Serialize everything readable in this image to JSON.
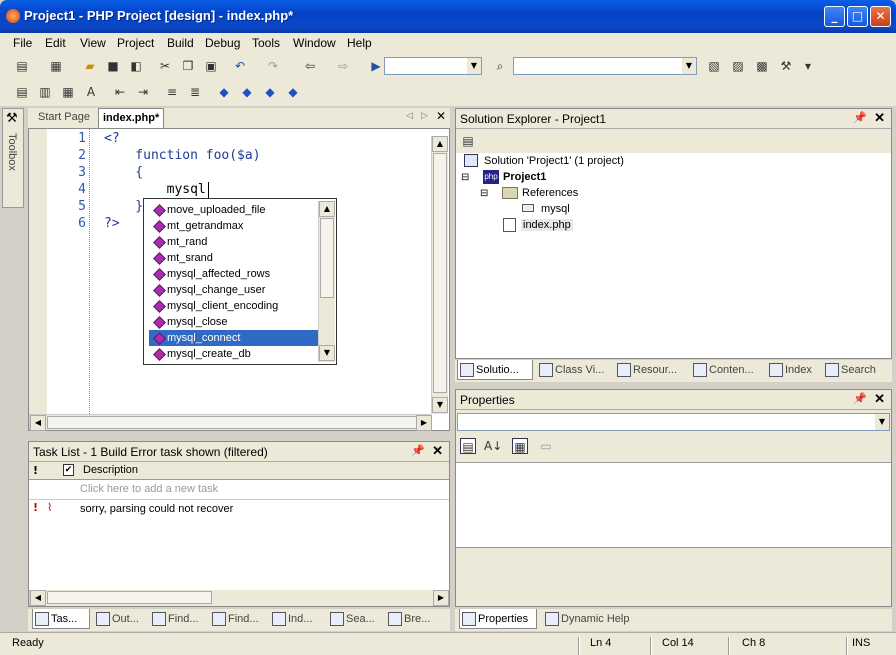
{
  "window": {
    "title": "Project1 - PHP Project [design] - index.php*",
    "min": "_",
    "max": "□",
    "close": "✕"
  },
  "menu": [
    "File",
    "Edit",
    "View",
    "Project",
    "Build",
    "Debug",
    "Tools",
    "Window",
    "Help"
  ],
  "toolbox": {
    "label": "Toolbox"
  },
  "editor": {
    "tabs": [
      "Start Page",
      "index.php*"
    ],
    "lines": [
      {
        "n": "1",
        "t": "<?"
      },
      {
        "n": "2",
        "t": "    function foo($a)"
      },
      {
        "n": "3",
        "t": "    {"
      },
      {
        "n": "4",
        "t": "        mysql"
      },
      {
        "n": "5",
        "t": "    }"
      },
      {
        "n": "6",
        "t": "?>"
      }
    ]
  },
  "autocomplete": {
    "items": [
      "move_uploaded_file",
      "mt_getrandmax",
      "mt_rand",
      "mt_srand",
      "mysql_affected_rows",
      "mysql_change_user",
      "mysql_client_encoding",
      "mysql_close",
      "mysql_connect",
      "mysql_create_db"
    ],
    "selected_index": 8
  },
  "tasklist": {
    "title": "Task List - 1 Build Error task shown (filtered)",
    "col_excl": "!",
    "col_check": "✔",
    "col_desc": "Description",
    "placeholder": "Click here to add a new task",
    "rows": [
      {
        "icon": "!",
        "desc": "sorry, parsing could not recover"
      }
    ]
  },
  "bottom_tabs": [
    "Tas...",
    "Out...",
    "Find...",
    "Find...",
    "Ind...",
    "Sea...",
    "Bre..."
  ],
  "solution": {
    "title": "Solution Explorer - Project1",
    "solution_label": "Solution 'Project1' (1 project)",
    "project": "Project1",
    "references": "References",
    "ref_item": "mysql",
    "file": "index.php"
  },
  "solution_tabs": [
    "Solutio...",
    "Class Vi...",
    "Resour...",
    "Conten...",
    "Index",
    "Search"
  ],
  "properties": {
    "title": "Properties",
    "tabs": [
      "Properties",
      "Dynamic Help"
    ]
  },
  "status": {
    "ready": "Ready",
    "ln": "Ln 4",
    "col": "Col 14",
    "ch": "Ch 8",
    "ins": "INS"
  }
}
